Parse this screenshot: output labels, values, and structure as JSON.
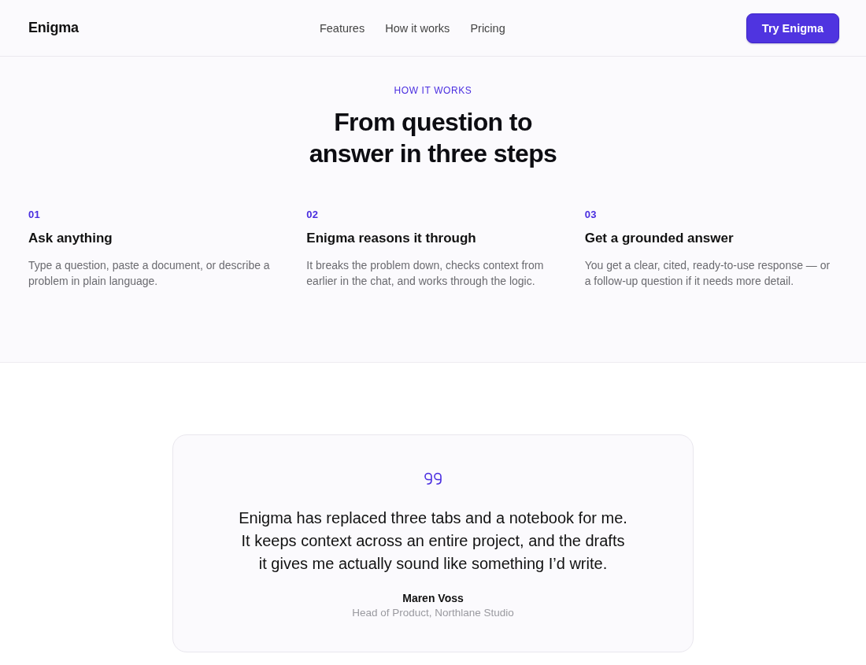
{
  "header": {
    "logo": "Enigma",
    "nav": [
      {
        "label": "Features"
      },
      {
        "label": "How it works"
      },
      {
        "label": "Pricing"
      }
    ],
    "cta": "Try Enigma"
  },
  "how_it_works": {
    "eyebrow": "HOW IT WORKS",
    "title": "From question to answer in three steps",
    "steps": [
      {
        "number": "01",
        "title": "Ask anything",
        "description": "Type a question, paste a document, or describe a problem in plain language."
      },
      {
        "number": "02",
        "title": "Enigma reasons it through",
        "description": "It breaks the problem down, checks context from earlier in the chat, and works through the logic."
      },
      {
        "number": "03",
        "title": "Get a grounded answer",
        "description": "You get a clear, cited, ready-to-use response — or a follow-up question if it needs more detail."
      }
    ]
  },
  "testimonial": {
    "quote": "Enigma has replaced three tabs and a notebook for me. It keeps context across an entire project, and the drafts it gives me actually sound like something I’d write.",
    "name": "Maren Voss",
    "role": "Head of Product, Northlane Studio"
  }
}
